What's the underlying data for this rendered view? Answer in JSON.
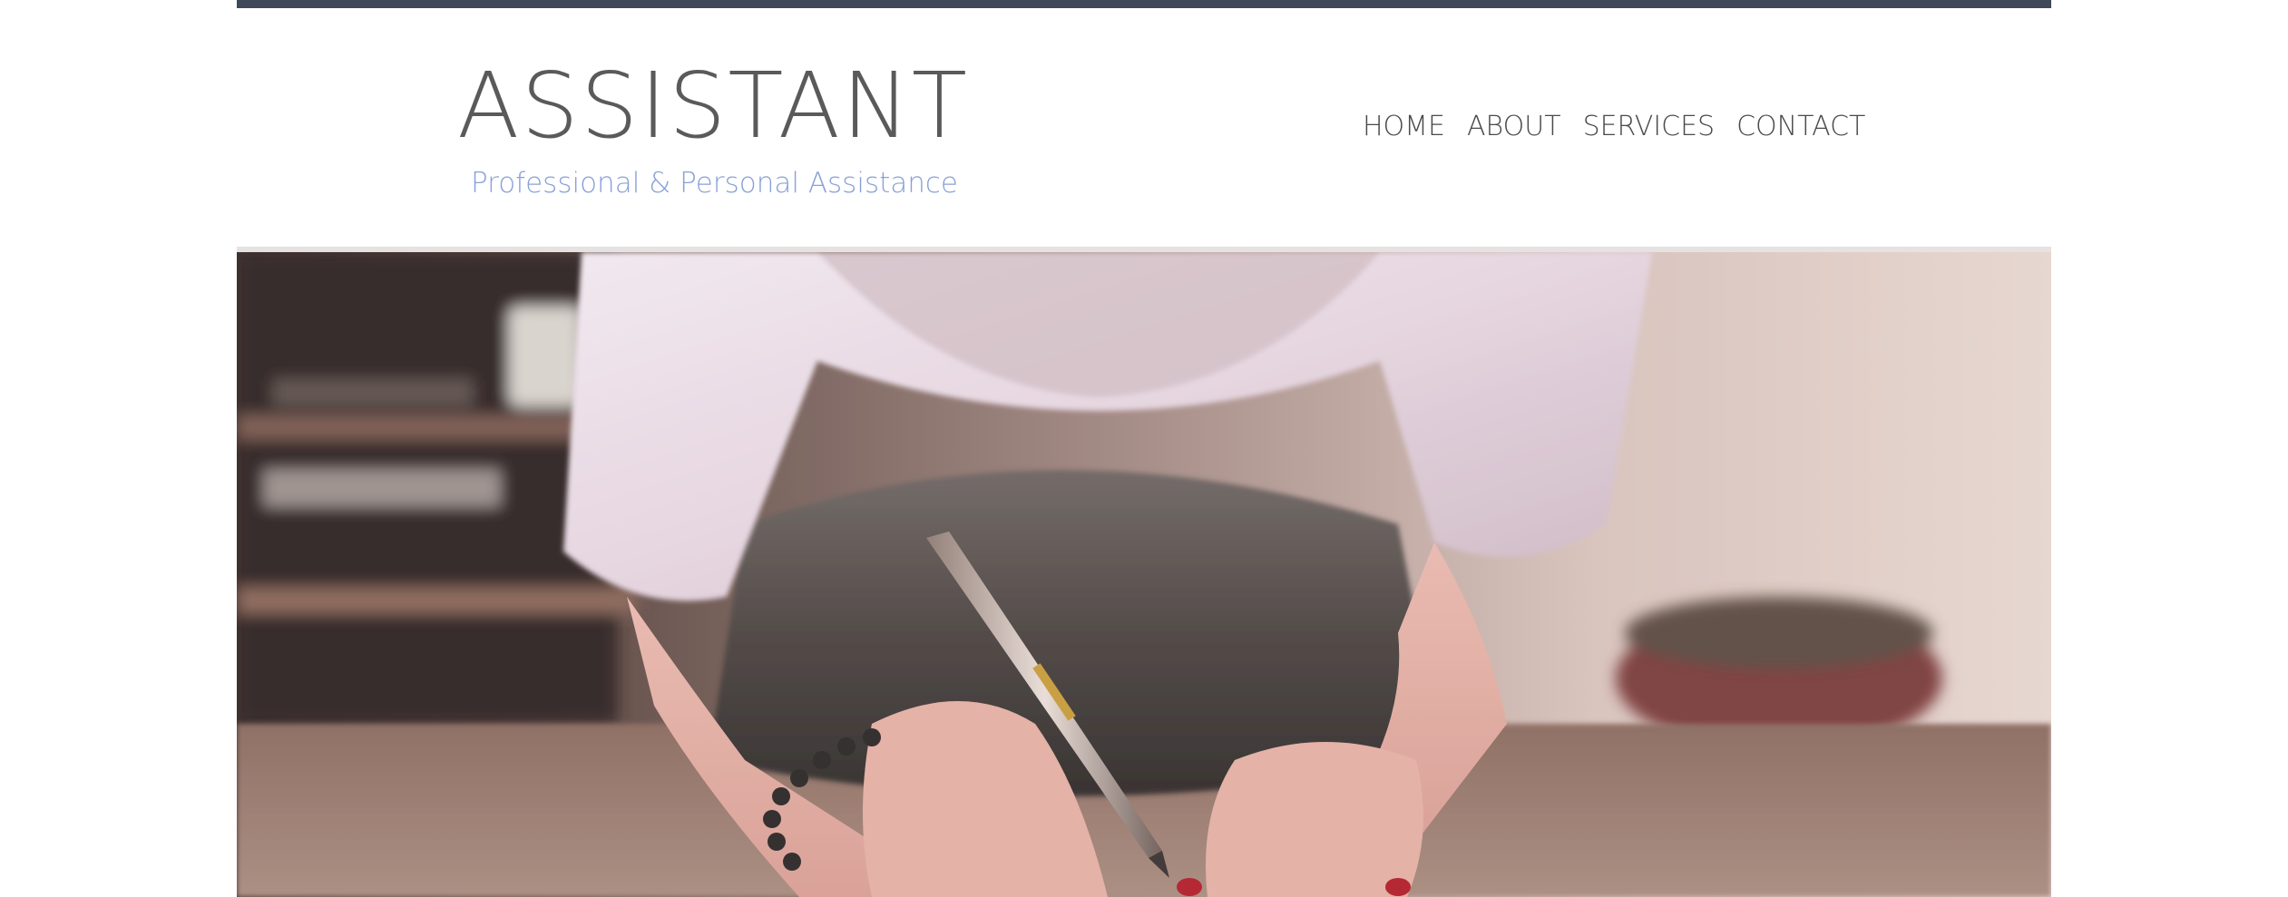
{
  "header": {
    "brand_title": "ASSISTANT",
    "brand_subtitle": "Professional & Personal Assistance"
  },
  "nav": {
    "items": [
      "HOME",
      "ABOUT",
      "SERVICES",
      "CONTACT"
    ]
  },
  "hero": {
    "image_subject": "woman-writing-with-pen-photo"
  },
  "colors": {
    "top_bar": "#3e4858",
    "title_text": "#5a5a5a",
    "subtitle_text": "#8aa1d6",
    "nav_text": "#4a4a4a",
    "divider": "#e6e2e2"
  }
}
